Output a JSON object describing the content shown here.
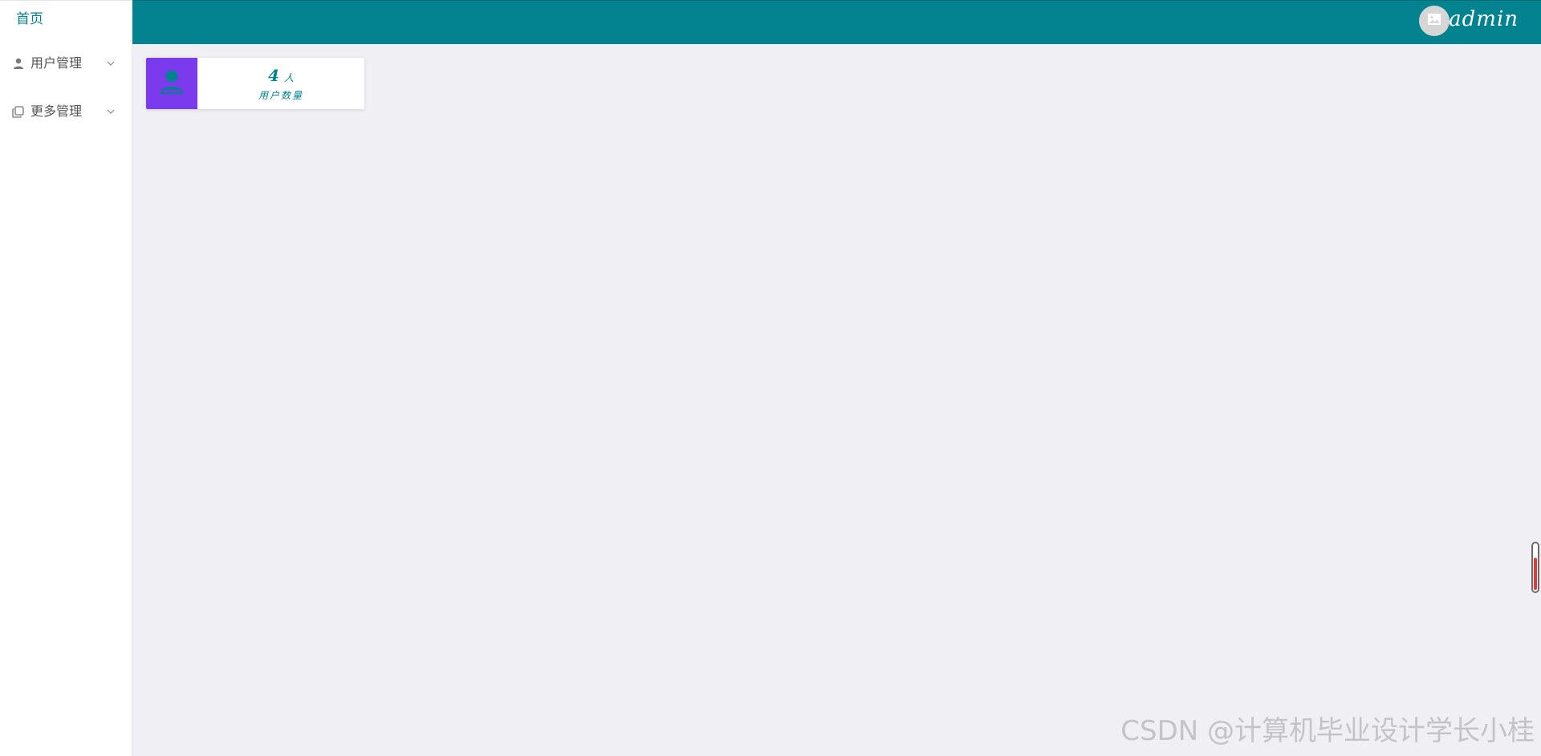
{
  "sidebar": {
    "home": "首页",
    "menus": [
      {
        "label": "用户管理",
        "icon": "user-icon"
      },
      {
        "label": "更多管理",
        "icon": "copy-icon"
      }
    ]
  },
  "header": {
    "username": "admin",
    "avatar_icon": "image-placeholder-icon",
    "bg_color": "#02838f"
  },
  "stats": [
    {
      "value": "4",
      "unit": "人",
      "label": "用户数量",
      "icon": "user-icon",
      "icon_bg": "#7c3aed"
    }
  ],
  "watermark": "CSDN @计算机毕业设计学长小桂"
}
